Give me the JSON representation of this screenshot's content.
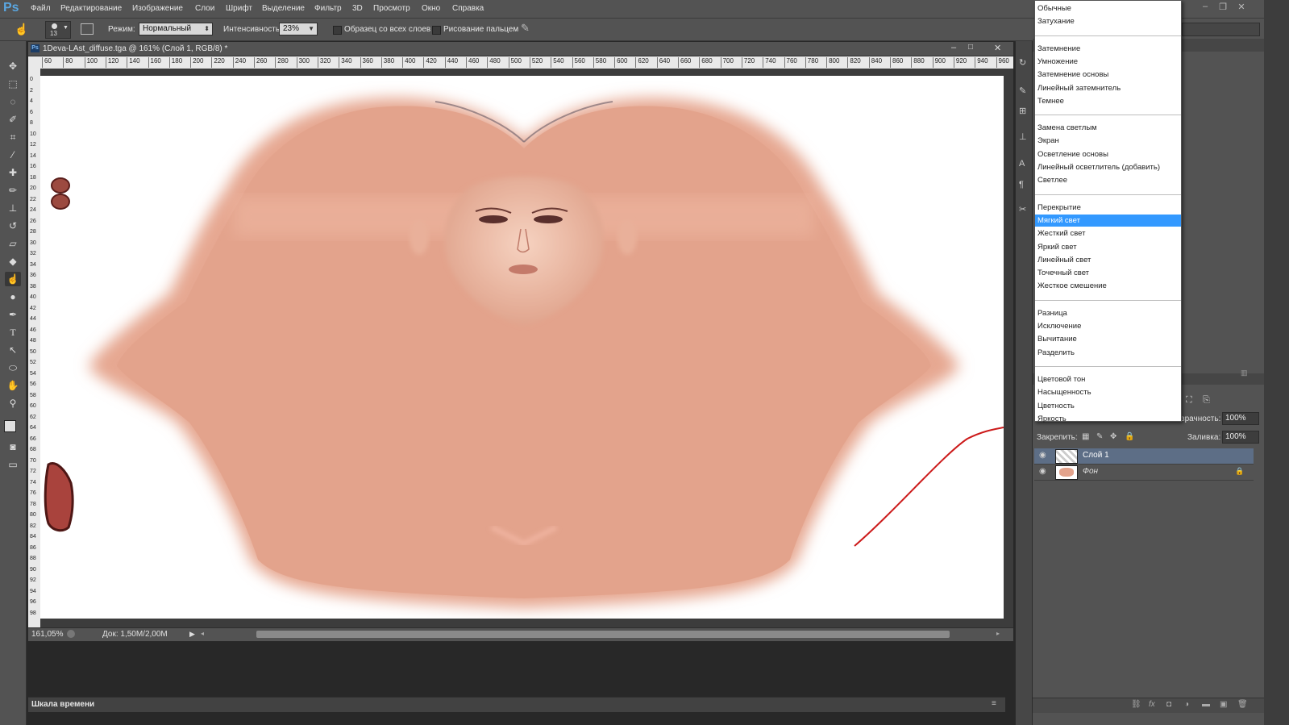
{
  "app": {
    "logo": "Ps"
  },
  "menu": [
    "Файл",
    "Редактирование",
    "Изображение",
    "Слои",
    "Шрифт",
    "Выделение",
    "Фильтр",
    "3D",
    "Просмотр",
    "Окно",
    "Справка"
  ],
  "options": {
    "brush_size": "13",
    "mode_label": "Режим:",
    "mode_value": "Нормальный",
    "strength_label": "Интенсивность:",
    "strength_value": "23%",
    "sample_all_label": "Образец со всех слоев",
    "finger_paint_label": "Рисование пальцем"
  },
  "document": {
    "title": "1Deva-LAst_diffuse.tga @ 161% (Слой 1, RGB/8) *",
    "ruler_h": [
      "60",
      "80",
      "100",
      "120",
      "140",
      "160",
      "180",
      "200",
      "220",
      "240",
      "260",
      "280",
      "300",
      "320",
      "340",
      "360",
      "380",
      "400",
      "420",
      "440",
      "460",
      "480",
      "500",
      "520",
      "540",
      "560",
      "580",
      "600",
      "620",
      "640",
      "660",
      "680",
      "700",
      "720",
      "740",
      "760",
      "780",
      "800",
      "820",
      "840",
      "860",
      "880",
      "900",
      "920",
      "940",
      "960"
    ],
    "ruler_v": [
      "0",
      "2",
      "4",
      "6",
      "8",
      "10",
      "12",
      "14",
      "16",
      "18",
      "20",
      "22",
      "24",
      "26",
      "28",
      "30",
      "32",
      "34",
      "36",
      "38",
      "40",
      "42",
      "44",
      "46",
      "48",
      "50",
      "52",
      "54",
      "56",
      "58",
      "60",
      "62",
      "64",
      "66",
      "68",
      "70",
      "72",
      "74",
      "76",
      "78",
      "80",
      "82",
      "84",
      "86",
      "88",
      "90",
      "92",
      "94",
      "96",
      "98"
    ]
  },
  "status": {
    "zoom": "161,05%",
    "doc_size": "Док: 1,50M/2,00M"
  },
  "timeline": {
    "label": "Шкала времени"
  },
  "blend_modes": {
    "groups": [
      [
        "Обычные",
        "Затухание"
      ],
      [
        "Затемнение",
        "Умножение",
        "Затемнение основы",
        "Линейный затемнитель",
        "Темнее"
      ],
      [
        "Замена светлым",
        "Экран",
        "Осветление основы",
        "Линейный осветлитель (добавить)",
        "Светлее"
      ],
      [
        "Перекрытие",
        "Мягкий свет",
        "Жесткий свет",
        "Яркий свет",
        "Линейный свет",
        "Точечный свет",
        "Жесткое смешение"
      ],
      [
        "Разница",
        "Исключение",
        "Вычитание",
        "Разделить"
      ],
      [
        "Цветовой тон",
        "Насыщенность",
        "Цветность",
        "Яркость"
      ]
    ],
    "selected": "Мягкий свет"
  },
  "layers_panel": {
    "opacity_label": "зрачность:",
    "opacity_value": "100%",
    "lock_label": "Закрепить:",
    "fill_label": "Заливка:",
    "fill_value": "100%",
    "layers": [
      {
        "name": "Слой 1",
        "selected": true
      },
      {
        "name": "Фон",
        "selected": false,
        "locked": true
      }
    ]
  },
  "colors": {
    "selection": "#3399ff",
    "skin": "#e8a791",
    "annotation_arrow": "#cc1a1a"
  }
}
